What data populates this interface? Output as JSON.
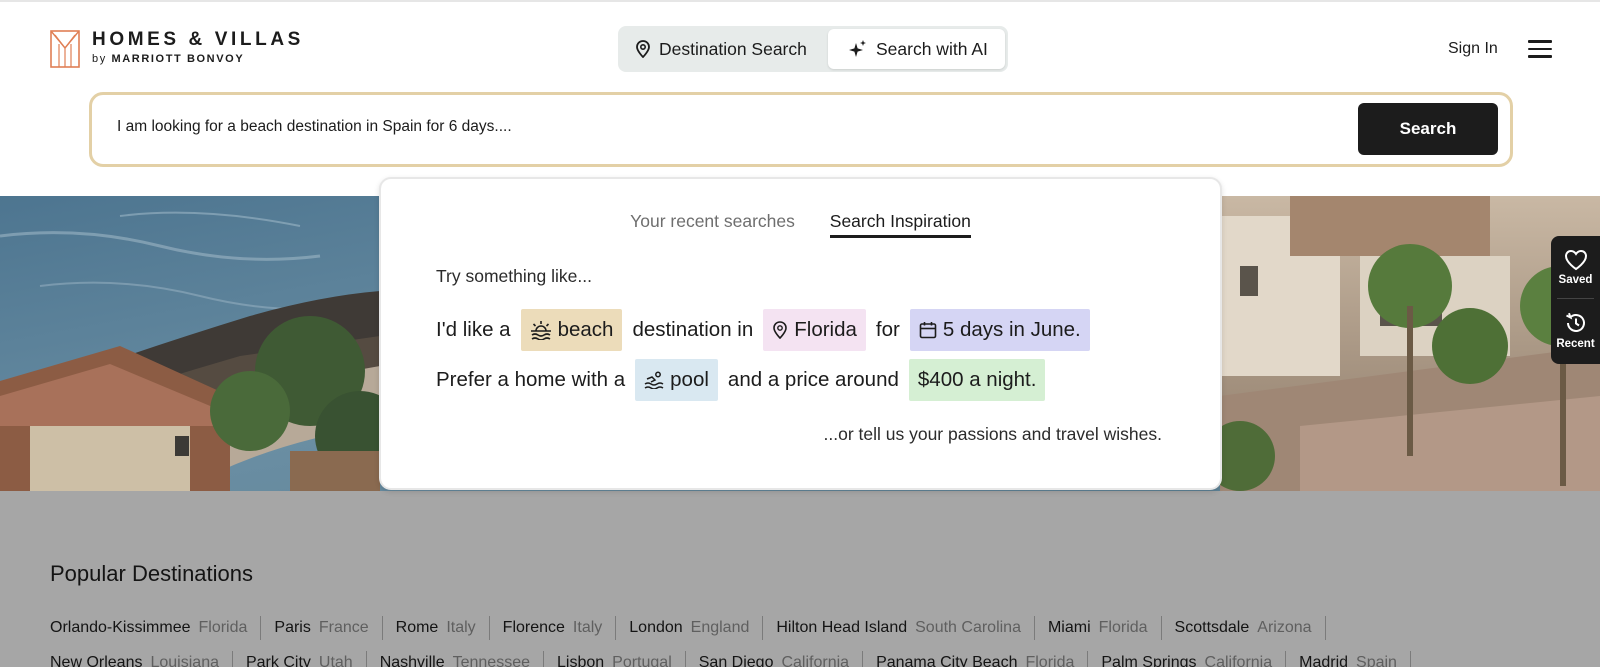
{
  "brand": {
    "title": "HOMES & VILLAS",
    "sub_by": "by",
    "sub_name": "MARRIOTT BONVOY"
  },
  "mode_toggle": {
    "destination_label": "Destination Search",
    "ai_label": "Search with AI"
  },
  "header": {
    "signin_label": "Sign In"
  },
  "search": {
    "value": "I am looking for a beach destination in Spain for 6 days....",
    "button_label": "Search"
  },
  "dropdown": {
    "tabs": [
      {
        "label": "Your recent searches",
        "active": false
      },
      {
        "label": "Search Inspiration",
        "active": true
      }
    ],
    "try_text": "Try something like...",
    "sentence1": {
      "t1": "I'd like a",
      "beach_chip": "beach",
      "t2": "destination in",
      "florida_chip": "Florida",
      "t3": "for",
      "days_chip": "5 days in June."
    },
    "sentence2": {
      "t1": "Prefer a home with a",
      "pool_chip": "pool",
      "t2": "and a price around",
      "price_chip": "$400 a night."
    },
    "tell_text": "...or tell us your passions and travel wishes.",
    "chip_colors": {
      "beach": "#ecdcba",
      "florida": "#f4e3f2",
      "days": "#d5d5f4",
      "pool": "#d9e8f1",
      "price": "#d5efd3"
    }
  },
  "side_widget": {
    "saved_label": "Saved",
    "recent_label": "Recent"
  },
  "popular": {
    "title": "Popular Destinations",
    "row1": [
      {
        "city": "Orlando-Kissimmee",
        "region": "Florida"
      },
      {
        "city": "Paris",
        "region": "France"
      },
      {
        "city": "Rome",
        "region": "Italy"
      },
      {
        "city": "Florence",
        "region": "Italy"
      },
      {
        "city": "London",
        "region": "England"
      },
      {
        "city": "Hilton Head Island",
        "region": "South Carolina"
      },
      {
        "city": "Miami",
        "region": "Florida"
      },
      {
        "city": "Scottsdale",
        "region": "Arizona"
      }
    ],
    "row2": [
      {
        "city": "New Orleans",
        "region": "Louisiana"
      },
      {
        "city": "Park City",
        "region": "Utah"
      },
      {
        "city": "Nashville",
        "region": "Tennessee"
      },
      {
        "city": "Lisbon",
        "region": "Portugal"
      },
      {
        "city": "San Diego",
        "region": "California"
      },
      {
        "city": "Panama City Beach",
        "region": "Florida"
      },
      {
        "city": "Palm Springs",
        "region": "California"
      },
      {
        "city": "Madrid",
        "region": "Spain"
      }
    ]
  },
  "colors": {
    "brand_gold": "#e3d0a6",
    "logo_orange": "#e07f55",
    "primary_dark": "#1c1c1c",
    "overlay_gray": "#a6a6a6"
  }
}
